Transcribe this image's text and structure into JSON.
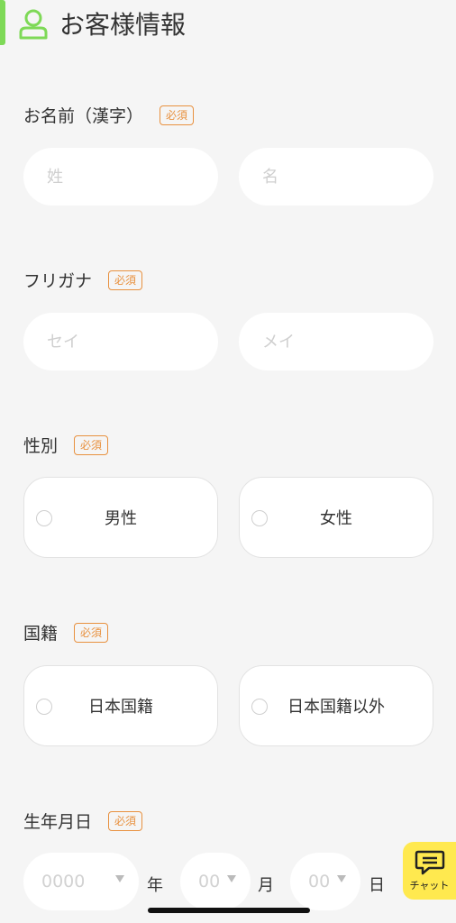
{
  "header": {
    "title": "お客様情報",
    "icon": "user-icon",
    "accent_color": "#7ed957"
  },
  "required_badge": "必須",
  "badge_color": "#e8913f",
  "name_kanji": {
    "label": "お名前（漢字）",
    "last_placeholder": "姓",
    "first_placeholder": "名"
  },
  "furigana": {
    "label": "フリガナ",
    "last_placeholder": "セイ",
    "first_placeholder": "メイ"
  },
  "gender": {
    "label": "性別",
    "options": [
      "男性",
      "女性"
    ]
  },
  "nationality": {
    "label": "国籍",
    "options": [
      "日本国籍",
      "日本国籍以外"
    ]
  },
  "birthdate": {
    "label": "生年月日",
    "year_value": "0000",
    "year_unit": "年",
    "month_value": "00",
    "month_unit": "月",
    "day_value": "00",
    "day_unit": "日"
  },
  "chat": {
    "label": "チャット",
    "icon": "chat-bubble-icon",
    "color": "#ffe94f"
  }
}
